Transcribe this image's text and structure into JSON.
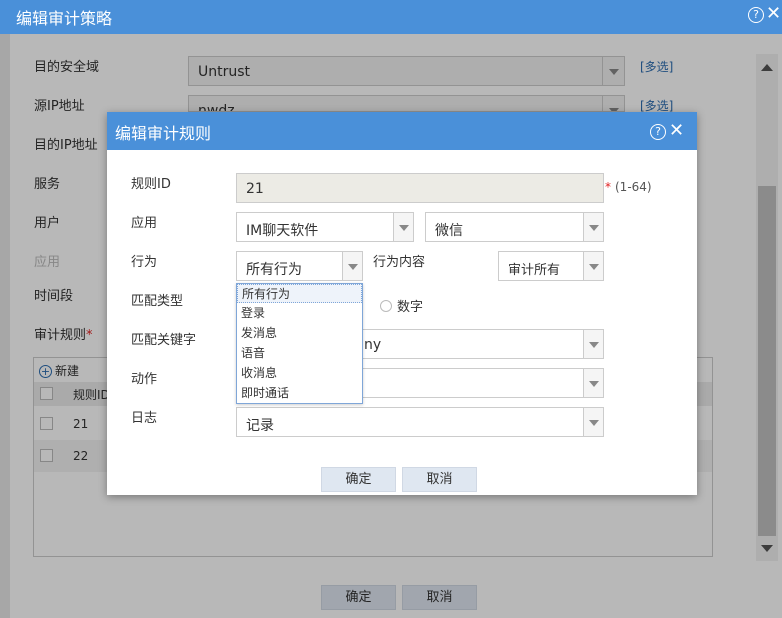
{
  "outer": {
    "title": "编辑审计策略",
    "fields": [
      {
        "label": "目的安全域",
        "value": "Untrust",
        "multi": "[多选]"
      },
      {
        "label": "源IP地址",
        "value": "nwdz",
        "multi": "[多选]"
      },
      {
        "label": "目的IP地址"
      },
      {
        "label": "服务"
      },
      {
        "label": "用户"
      },
      {
        "label": "应用"
      },
      {
        "label": "时间段"
      },
      {
        "label": "审计规则",
        "required_mark": "*"
      }
    ],
    "table": {
      "toolbar": {
        "add_label": "新建",
        "add_icon": "plus-circle-icon"
      },
      "header": [
        "规则ID"
      ],
      "rows": [
        {
          "id": "21"
        },
        {
          "id": "22"
        }
      ]
    },
    "ok_label": "确定",
    "cancel_label": "取消"
  },
  "dialog": {
    "title": "编辑审计规则",
    "rule_id_label": "规则ID",
    "rule_id_value": "21",
    "rule_id_hint_mark": "*",
    "rule_id_hint": "(1-64)",
    "app_label": "应用",
    "app_category": "IM聊天软件",
    "app_name": "微信",
    "behavior_label": "行为",
    "behavior_value": "所有行为",
    "behavior_content_label": "行为内容",
    "behavior_content_value": "审计所有",
    "match_type_label": "匹配类型",
    "match_type_option_number": "数字",
    "match_keyword_label": "匹配关键字",
    "match_keyword_value": "ny",
    "action_label": "动作",
    "log_label": "日志",
    "log_value": "记录",
    "ok_label": "确定",
    "cancel_label": "取消"
  },
  "behavior_dropdown": {
    "options": [
      "所有行为",
      "登录",
      "发消息",
      "语音",
      "收消息",
      "即时通话"
    ],
    "selected_index": 0
  },
  "icons": {
    "help": "?",
    "close": "✕"
  },
  "colors": {
    "header": "#4a90d9",
    "link": "#2b6cb0",
    "required": "#e02020"
  }
}
